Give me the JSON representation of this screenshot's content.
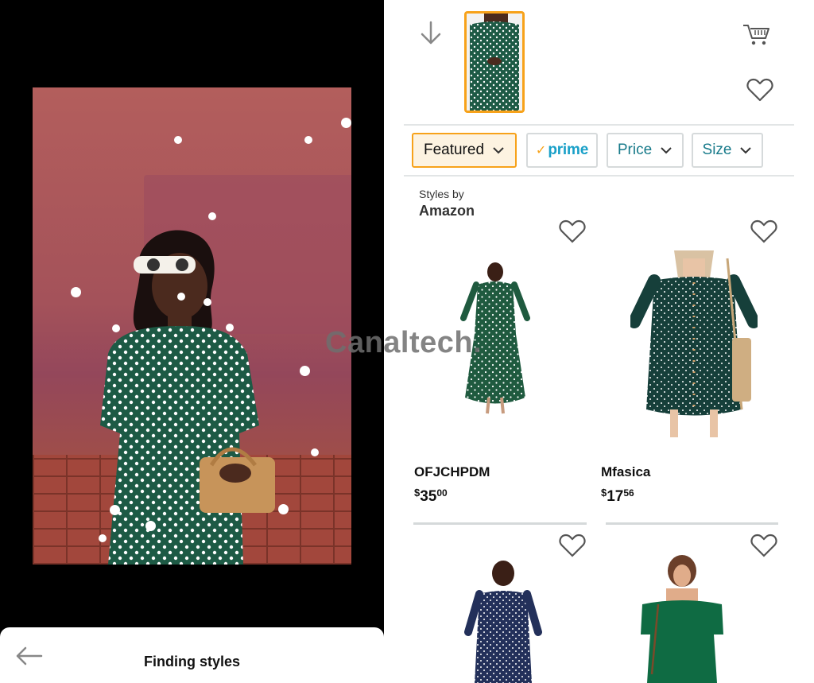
{
  "left_panel": {
    "bottom_sheet": {
      "title": "Finding styles",
      "back_icon": "arrow-left-icon"
    }
  },
  "top_bar": {
    "download_icon": "arrow-down-icon",
    "cart_icon": "cart-icon",
    "save_icon": "heart-icon"
  },
  "filters": [
    {
      "label": "Featured",
      "active": true
    },
    {
      "label": "prime",
      "prefix": "✓"
    },
    {
      "label": "Price"
    },
    {
      "label": "Size"
    }
  ],
  "section": {
    "styles_by": "Styles by",
    "brand": "Amazon"
  },
  "products": [
    {
      "name": "OFJCHPDM",
      "price_symbol": "$",
      "price_dollars": "35",
      "price_cents": "00"
    },
    {
      "name": "Mfasica",
      "price_symbol": "$",
      "price_dollars": "17",
      "price_cents": "56"
    }
  ],
  "watermark": "Canaltech.",
  "colors": {
    "accent": "#f7a21a",
    "teal": "#177a8a",
    "prime": "#19a0c8",
    "dress_green": "#1d5a45"
  }
}
